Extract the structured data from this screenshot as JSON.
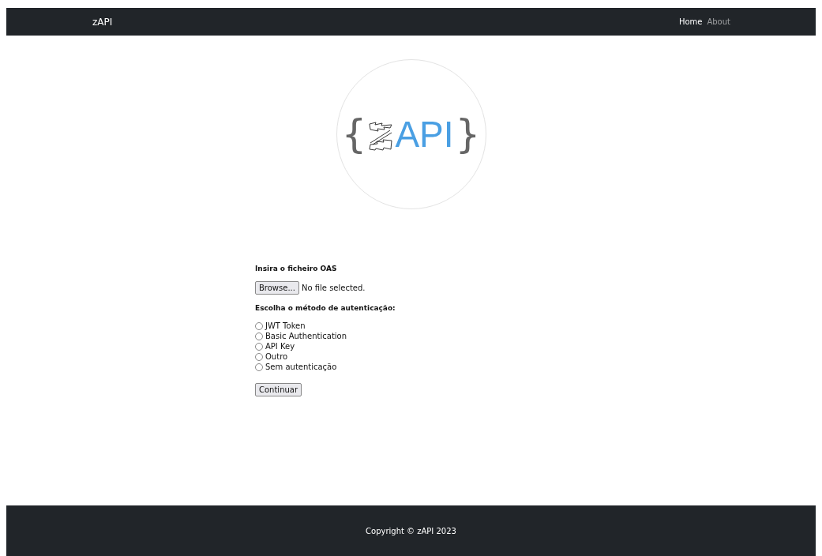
{
  "navbar": {
    "brand": "zAPI",
    "links": [
      {
        "label": "Home",
        "selected": true
      },
      {
        "label": "About",
        "selected": false
      }
    ]
  },
  "logo": {
    "open_brace": "{",
    "name": "API",
    "close_brace": "}"
  },
  "form": {
    "file_label": "Insira o ficheiro OAS",
    "browse_button": "Browse...",
    "file_status": "No file selected.",
    "auth_label": "Escolha o método de autenticação:",
    "auth_options": [
      {
        "label": "JWT Token",
        "selected": false
      },
      {
        "label": "Basic Authentication",
        "selected": false
      },
      {
        "label": "API Key",
        "selected": false
      },
      {
        "label": "Outro",
        "selected": false
      },
      {
        "label": "Sem autenticação",
        "selected": false
      }
    ],
    "submit_button": "Continuar"
  },
  "footer": {
    "text": "Copyright © zAPI 2023"
  }
}
